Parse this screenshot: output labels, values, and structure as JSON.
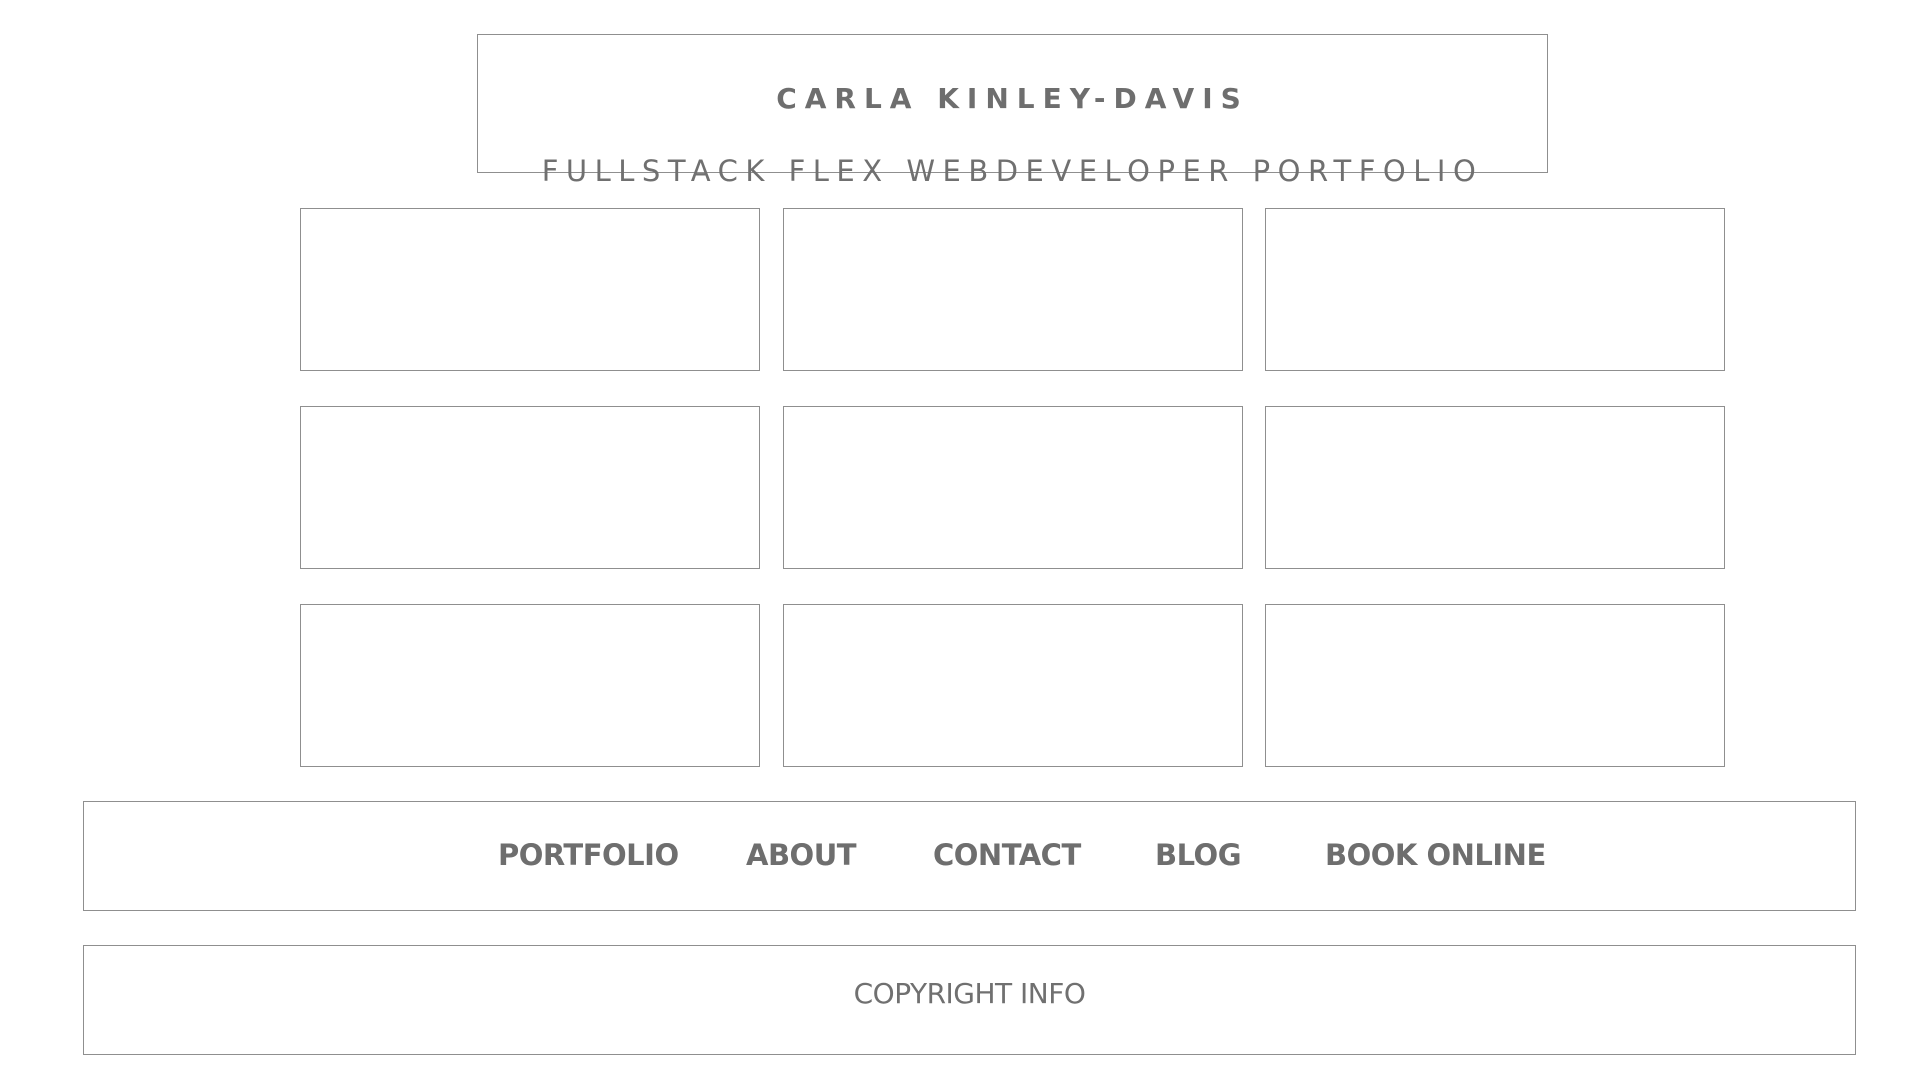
{
  "header": {
    "name": "CARLA KINLEY-DAVIS",
    "subtitle": "FULLSTACK FLEX WEBDEVELOPER PORTFOLIO"
  },
  "nav": {
    "items": [
      {
        "label": "PORTFOLIO"
      },
      {
        "label": "ABOUT"
      },
      {
        "label": "CONTACT"
      },
      {
        "label": "BLOG"
      },
      {
        "label": "BOOK ONLINE"
      }
    ]
  },
  "footer": {
    "copyright": "COPYRIGHT INFO"
  },
  "colors": {
    "border": "#8f8f8f",
    "text": "#6e6e6e",
    "background": "#ffffff"
  }
}
